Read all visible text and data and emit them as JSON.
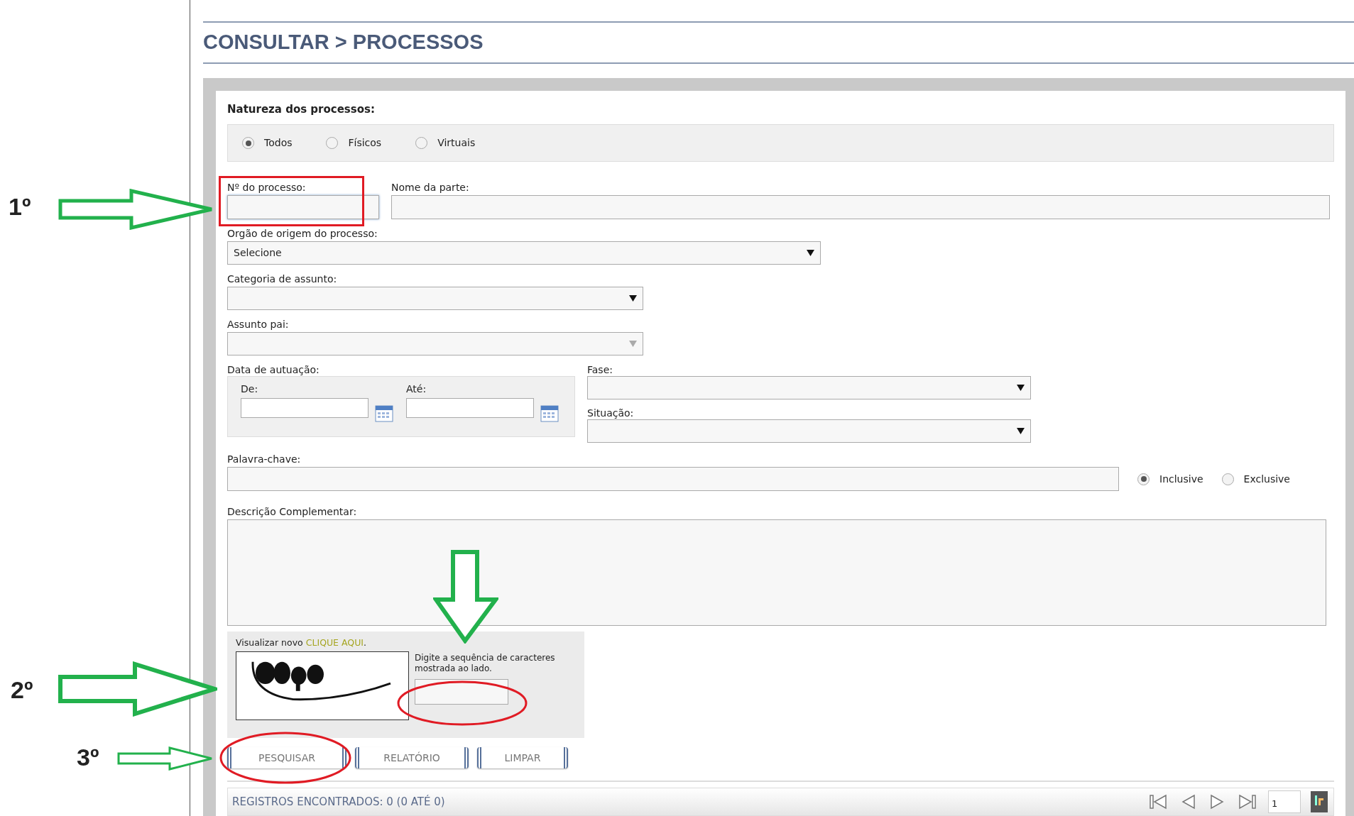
{
  "header": {
    "title": "CONSULTAR > PROCESSOS"
  },
  "form": {
    "natureza": {
      "label": "Natureza dos processos:",
      "options": [
        {
          "label": "Todos",
          "selected": true
        },
        {
          "label": "Físicos",
          "selected": false
        },
        {
          "label": "Virtuais",
          "selected": false
        }
      ]
    },
    "numero": {
      "label": "Nº do processo:",
      "focused": true
    },
    "nome_parte": {
      "label": "Nome da parte:"
    },
    "orgao": {
      "label": "Orgão de origem do processo:",
      "value": "Selecione",
      "disabled": false
    },
    "categoria": {
      "label": "Categoria de assunto:",
      "disabled": false
    },
    "assunto_pai": {
      "label": "Assunto pai:",
      "disabled": true
    },
    "data": {
      "label": "Data de autuação:",
      "from_label": "De:",
      "to_label": "Até:"
    },
    "fase": {
      "label": "Fase:",
      "disabled": false
    },
    "situacao": {
      "label": "Situação:",
      "disabled": false
    },
    "palavra_chave": {
      "label": "Palavra-chave:",
      "options": [
        {
          "label": "Inclusive",
          "selected": true
        },
        {
          "label": "Exclusive",
          "selected": false
        }
      ]
    },
    "descricao": {
      "label": "Descrição Complementar:"
    },
    "captcha": {
      "refresh_text": "Visualizar novo",
      "refresh_link": "CLIQUE AQUI",
      "refresh_end": ".",
      "instruction": "Digite a sequência de caracteres mostrada ao lado."
    },
    "buttons": [
      "PESQUISAR",
      "RELATÓRIO",
      "LIMPAR"
    ]
  },
  "results": {
    "summary": "REGISTROS ENCONTRADOS: 0 (0 ATÉ 0)",
    "page": "1"
  },
  "step_labels": [
    "1º",
    "2º",
    "3º"
  ]
}
